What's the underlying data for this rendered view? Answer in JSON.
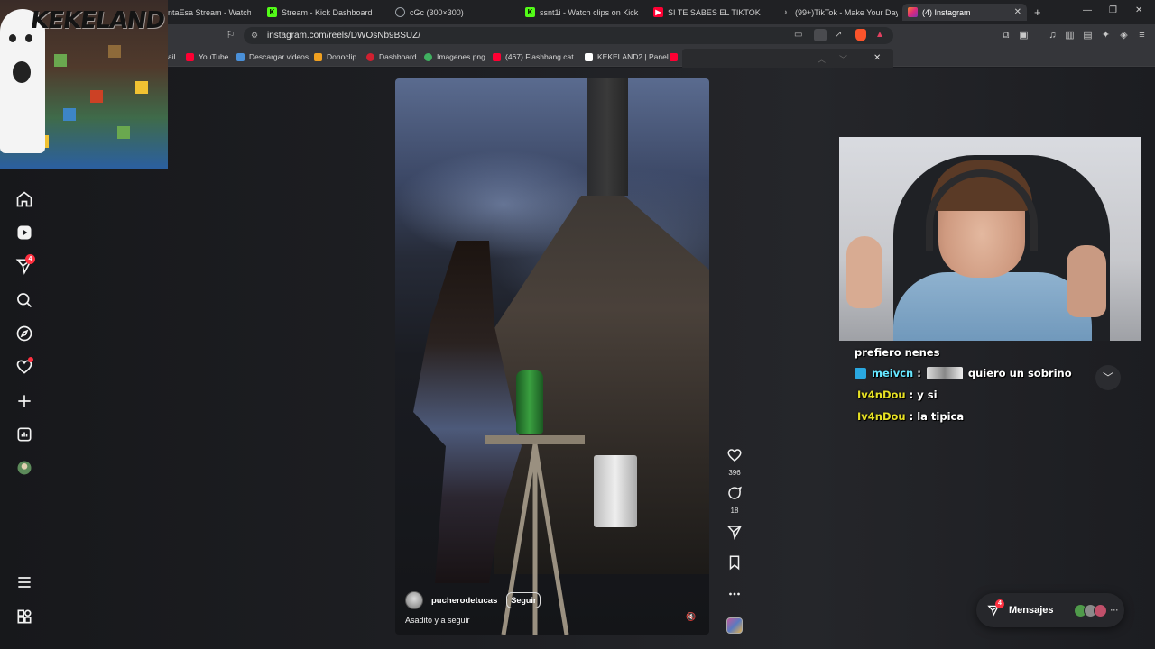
{
  "browser": {
    "tabs": [
      {
        "label": "ntaEsa Stream - Watch Li",
        "icon_color": "#53fc18",
        "icon": "K"
      },
      {
        "label": "Stream - Kick Dashboard",
        "icon_color": "#53fc18",
        "icon": "K"
      },
      {
        "label": "cGc (300×300)",
        "icon_color": "#9aa0a6",
        "icon": "globe-icon"
      },
      {
        "label": "ssnt1i - Watch clips on Kick",
        "icon_color": "#53fc18",
        "icon": "K"
      },
      {
        "label": "SI TE SABES EL TIKTOK BAILA",
        "icon_color": "#ff0033",
        "icon": "youtube-icon"
      },
      {
        "label": "(99+)TikTok - Make Your Day",
        "icon_color": "#ffffff",
        "icon": "tiktok-icon"
      },
      {
        "label": "(4) Instagram",
        "icon_color": "#e1306c",
        "icon": "instagram-icon",
        "active": true
      }
    ],
    "url": "instagram.com/reels/DWOsNb9BSUZ/",
    "bookmarks": [
      {
        "label": "ail",
        "color": "#c0c0c0"
      },
      {
        "label": "YouTube",
        "color": "#ff0033"
      },
      {
        "label": "Descargar videos",
        "color": "#4a90d9"
      },
      {
        "label": "Donoclip",
        "color": "#f0a020"
      },
      {
        "label": "Dashboard",
        "color": "#d02030"
      },
      {
        "label": "Imagenes png",
        "color": "#40b060"
      },
      {
        "label": "(467) Flashbang cat...",
        "color": "#ff0033"
      },
      {
        "label": "KEKELAND2 | Panel",
        "color": "#ffffff"
      }
    ]
  },
  "overlay": {
    "logo_text": "KEKELAND"
  },
  "instagram": {
    "nav_badges": {
      "reels_share": "4"
    },
    "reel": {
      "username": "pucherodetucas",
      "follow_label": "Seguir",
      "caption": "Asadito y a seguir",
      "likes": "396",
      "comments": "18"
    },
    "messages": {
      "label": "Mensajes",
      "badge": "4"
    }
  },
  "chat": {
    "lines": [
      {
        "user": "",
        "text": "prefiero nenes"
      },
      {
        "user": "meivcn",
        "text": "quiero un sobrino",
        "emote": true
      },
      {
        "user": "Iv4nDou",
        "text": "y si"
      },
      {
        "user": "Iv4nDou",
        "text": "la tipica"
      }
    ]
  }
}
